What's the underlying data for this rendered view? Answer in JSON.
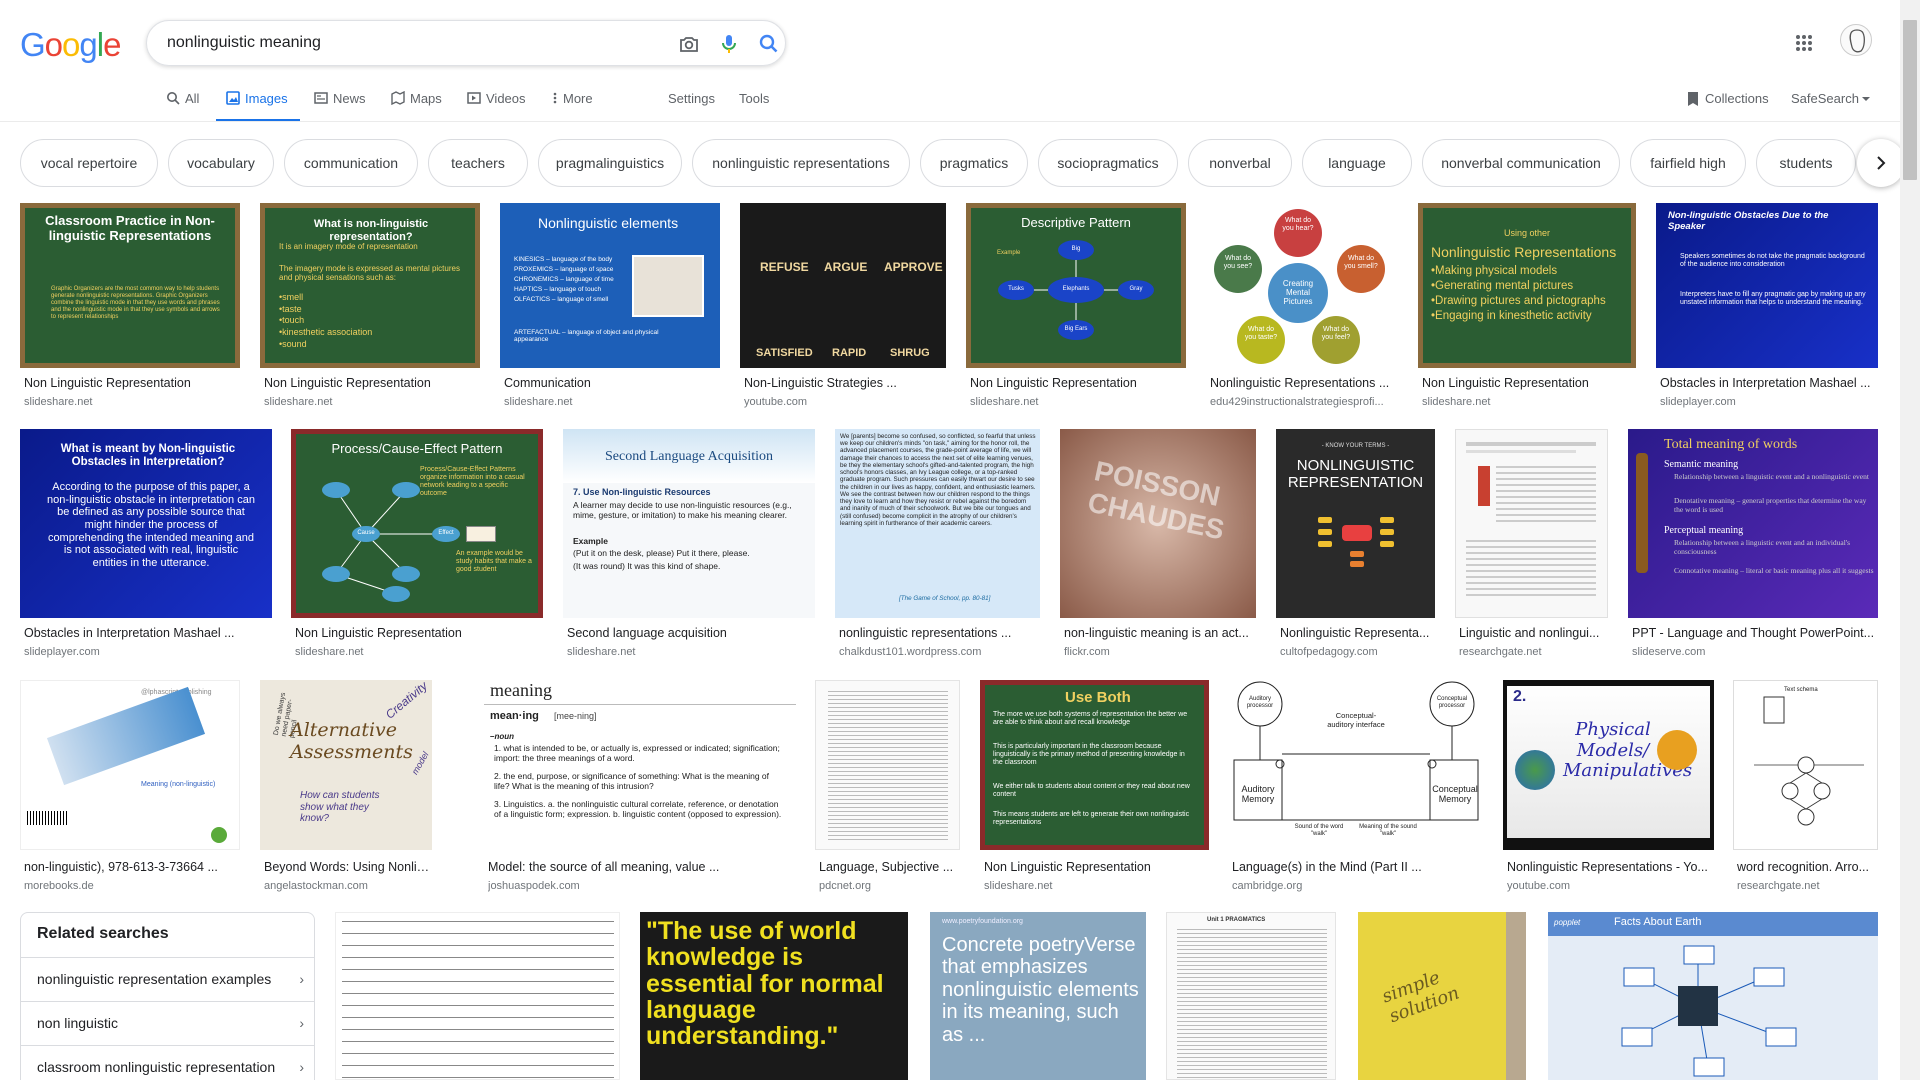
{
  "search": {
    "query": "nonlinguistic meaning"
  },
  "nav": {
    "tabs": [
      "All",
      "Images",
      "News",
      "Maps",
      "Videos",
      "More"
    ],
    "settings": "Settings",
    "tools": "Tools",
    "collections": "Collections",
    "safesearch": "SafeSearch"
  },
  "chips": [
    "vocal repertoire",
    "vocabulary",
    "communication",
    "teachers",
    "pragmalinguistics",
    "nonlinguistic representations",
    "pragmatics",
    "sociopragmatics",
    "nonverbal",
    "language",
    "nonverbal communication",
    "fairfield high",
    "students"
  ],
  "results": [
    {
      "title": "Non Linguistic Representation",
      "source": "slideshare.net"
    },
    {
      "title": "Non Linguistic Representation",
      "source": "slideshare.net"
    },
    {
      "title": "Communication",
      "source": "slideshare.net"
    },
    {
      "title": "Non-Linguistic Strategies ...",
      "source": "youtube.com"
    },
    {
      "title": "Non Linguistic Representation",
      "source": "slideshare.net"
    },
    {
      "title": "Nonlinguistic Representations ...",
      "source": "edu429instructionalstrategiesprofi..."
    },
    {
      "title": "Non Linguistic Representation",
      "source": "slideshare.net"
    },
    {
      "title": "Obstacles in Interpretation Mashael ...",
      "source": "slideplayer.com"
    },
    {
      "title": "Obstacles in Interpretation Mashael ...",
      "source": "slideplayer.com"
    },
    {
      "title": "Non Linguistic Representation",
      "source": "slideshare.net"
    },
    {
      "title": "Second language acquisition",
      "source": "slideshare.net"
    },
    {
      "title": "nonlinguistic representations ...",
      "source": "chalkdust101.wordpress.com"
    },
    {
      "title": "non-linguistic meaning is an act...",
      "source": "flickr.com"
    },
    {
      "title": "Nonlinguistic Representa...",
      "source": "cultofpedagogy.com"
    },
    {
      "title": "Linguistic and nonlingui...",
      "source": "researchgate.net"
    },
    {
      "title": "PPT - Language and Thought PowerPoint...",
      "source": "slideserve.com"
    },
    {
      "title": "non-linguistic), 978-613-3-73664 ...",
      "source": "morebooks.de"
    },
    {
      "title": "Beyond Words: Using Nonlinguist...",
      "source": "angelastockman.com"
    },
    {
      "title": "Model: the source of all meaning, value ...",
      "source": "joshuaspodek.com"
    },
    {
      "title": "Language, Subjective ...",
      "source": "pdcnet.org"
    },
    {
      "title": "Non Linguistic Representation",
      "source": "slideshare.net"
    },
    {
      "title": "Language(s) in the Mind (Part II ...",
      "source": "cambridge.org"
    },
    {
      "title": "Nonlinguistic Representations - Yo...",
      "source": "youtube.com"
    },
    {
      "title": "word recognition. Arro...",
      "source": "researchgate.net"
    }
  ],
  "thumbs": {
    "t1": {
      "title": "Classroom Practice in Non-linguistic Representations",
      "body": "Graphic Organizers are the most common way to help students generate nonlinguistic representations. Graphic Organizers combine the linguistic mode in that they use words and phrases and the nonlinguistic mode in that they use symbols and arrows to represent relationships"
    },
    "t2": {
      "title": "What is non-linguistic representation?",
      "line1": "It is an imagery mode of representation",
      "line2": "The imagery mode is expressed as mental pictures and physical sensations such as:",
      "items": [
        "•smell",
        "•taste",
        "•touch",
        "•kinesthetic association",
        "•sound"
      ]
    },
    "t3": {
      "title": "Nonlinguistic elements",
      "items": [
        "KINESICS – language of the body",
        "PROXEMICS – language of space",
        "CHRONEMICS – language of time",
        "HAPTICS – language of touch",
        "OLFACTICS – language of smell",
        "ARTEFACTUAL – language of object and physical appearance"
      ]
    },
    "t4": {
      "words": [
        "REFUSE",
        "ARGUE",
        "APPROVE",
        "SATISFIED",
        "RAPID",
        "SHRUG"
      ]
    },
    "t5": {
      "title": "Descriptive Pattern",
      "label": "Example",
      "center": "Elephants",
      "nodes": [
        "Big",
        "Tusks",
        "Gray",
        "Big Ears"
      ]
    },
    "t6": {
      "center": "Creating Mental Pictures",
      "petals": [
        "What do you hear?",
        "What do you smell?",
        "What do you feel?",
        "What do you taste?",
        "What do you see?"
      ]
    },
    "t7": {
      "heading": "Using other",
      "title": "Nonlinguistic Representations",
      "items": [
        "•Making physical models",
        "•Generating mental pictures",
        "•Drawing pictures and pictographs",
        "•Engaging in kinesthetic activity"
      ]
    },
    "t8": {
      "title": "Non-linguistic Obstacles Due to the Speaker",
      "items": [
        "Speakers sometimes do not take the pragmatic background of the audience into consideration",
        "Interpreters have to fill any pragmatic gap by making up any unstated information that helps to understand the meaning."
      ]
    },
    "t9": {
      "title": "What is meant by Non-linguistic Obstacles in Interpretation?",
      "body": "According to the purpose of this paper, a non-linguistic obstacle in interpretation can be defined as any possible source that might hinder the process of comprehending the intended meaning and is not associated with real, linguistic entities in the utterance."
    },
    "t10": {
      "title": "Process/Cause-Effect Pattern",
      "body": "Process/Cause-Effect Patterns organize information into a casual network leading to a specific outcome",
      "note": "An example would be study habits that make a good student",
      "node": "Cause",
      "effect": "Effect"
    },
    "t11": {
      "title": "Second Language Acquisition",
      "h": "7. Use Non-linguistic Resources",
      "p1": "A learner may decide to use non-linguistic resources (e.g., mime, gesture, or imitation) to make his meaning clearer.",
      "ex": "Example",
      "p2": "(Put it on the desk, please) Put it there, please.",
      "p3": "(It was round) It was this kind of shape."
    },
    "t12": {
      "body": "We [parents] become so confused, so conflicted, so fearful that unless we keep our children's minds \"on task,\" aiming for the honor roll, the advanced placement courses, the grade-point average of life, we will damage their chances to access the next set of elite learning venues, be they the elementary school's gifted-and-talented program, the high school's honors classes, an Ivy League college, or a top-ranked graduate program. Such pressures can easily thwart our desire to see the children in our lives as happy, confident, and enthusiastic learners. We see the contrast between how our children respond to the things they love to learn and how they resist or rebel against the boredom and inanity of much of their schoolwork. But we bite our tongues and (still confused) become complicit in the atrophy of our children's learning spirit in furtherance of their academic careers.",
      "cite": "[The Game of School, pp. 80-81]"
    },
    "t13": {
      "text": "POISSON CHAUDES"
    },
    "t14": {
      "small": "- KNOW YOUR TERMS -",
      "title": "NONLINGUISTIC REPRESENTATION"
    },
    "t16": {
      "title": "Total meaning of words",
      "items": [
        "Semantic meaning",
        "Relationship between a linguistic event and a nonlinguistic event",
        "Denotative meaning – general properties that determine the way the word is used",
        "Perceptual meaning",
        "Relationship between a linguistic event and an individual's consciousness",
        "Connotative meaning – literal or basic meaning plus all it suggests"
      ]
    },
    "t17": {
      "brand": "@lphascript publishing",
      "line": "Meaning (non-linguistic)"
    },
    "t18": {
      "words": [
        "Do we always need paper-pencil",
        "Alternative Assessments",
        "How can students show what they know?",
        "Creativity",
        "model"
      ]
    },
    "t19": {
      "word": "meaning",
      "pron": "mean·ing",
      "pronsub": "[mee-ning]",
      "pos": "–noun",
      "defs": [
        "1. what is intended to be, or actually is, expressed or indicated; signification; import: the three meanings of a word.",
        "2. the end, purpose, or significance of something: What is the meaning of life? What is the meaning of this intrusion?",
        "3. Linguistics. a. the nonlinguistic cultural correlate, reference, or denotation of a linguistic form; expression. b. linguistic content (opposed to expression)."
      ]
    },
    "t21": {
      "title": "Use Both",
      "items": [
        "The more we use both systems of representation the better we are able to think about and recall knowledge",
        "This is particularly important in the classroom because linguistically is the primary method of presenting knowledge in the classroom",
        "We either talk to students about content or they read about new content",
        "This means students are left to generate their own nonlinguistic representations"
      ]
    },
    "t22": {
      "top": "Conceptual-auditory interface",
      "a": "Auditory processor",
      "b": "Conceptual processor",
      "c": "Auditory Memory",
      "d": "Conceptual Memory",
      "e": "Sound of the word \"walk\"",
      "f": "Meaning of the sound \"walk\""
    },
    "t23": {
      "num": "2.",
      "text": "Physical Models/ Manipulatives"
    },
    "t24": {
      "text": "Text schema"
    },
    "r1": {
      "text": "\"The use of world knowledge is essential for normal language understanding.\""
    },
    "r2": {
      "site": "www.poetryfoundation.org",
      "text": "Concrete poetryVerse that emphasizes nonlinguistic elements in its meaning, such as ..."
    },
    "r3": {
      "title": "Unit 1 PRAGMATICS"
    },
    "r4": {
      "text": "simple solution"
    },
    "r5": {
      "brand": "popplet",
      "title": "Facts About Earth"
    }
  },
  "related": {
    "heading": "Related searches",
    "items": [
      "nonlinguistic representation examples",
      "non linguistic",
      "classroom nonlinguistic representation"
    ]
  }
}
